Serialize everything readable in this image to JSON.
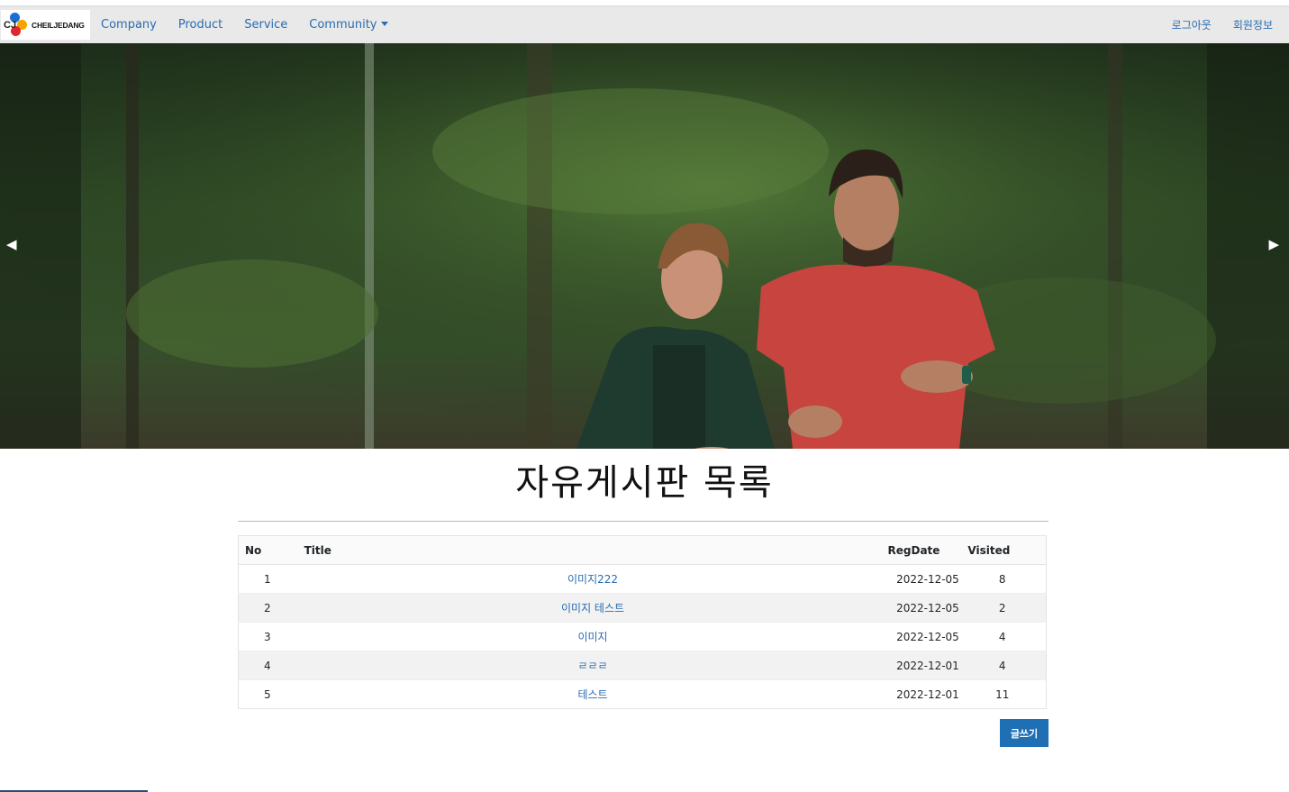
{
  "navbar": {
    "logo_text": "CHEILJEDANG",
    "logo_mark": "CJ",
    "menu": [
      "Company",
      "Product",
      "Service",
      "Community"
    ],
    "right": [
      "로그아웃",
      "회원정보"
    ]
  },
  "carousel": {
    "prev": "◀",
    "next": "▶",
    "image_alt": "two people running in a forest"
  },
  "page": {
    "title": "자유게시판 목록",
    "write_button": "글쓰기"
  },
  "table": {
    "headers": {
      "no": "No",
      "title": "Title",
      "regdate": "RegDate",
      "visited": "Visited"
    },
    "rows": [
      {
        "no": "1",
        "title": "이미지222",
        "regdate": "2022-12-05",
        "visited": "8"
      },
      {
        "no": "2",
        "title": "이미지 테스트",
        "regdate": "2022-12-05",
        "visited": "2"
      },
      {
        "no": "3",
        "title": "이미지",
        "regdate": "2022-12-05",
        "visited": "4"
      },
      {
        "no": "4",
        "title": "ㄹㄹㄹ",
        "regdate": "2022-12-01",
        "visited": "4"
      },
      {
        "no": "5",
        "title": "테스트",
        "regdate": "2022-12-01",
        "visited": "11"
      }
    ]
  },
  "colors": {
    "link": "#2a6cb0",
    "button": "#1f6fb4",
    "navbar": "#e9e9e9"
  }
}
